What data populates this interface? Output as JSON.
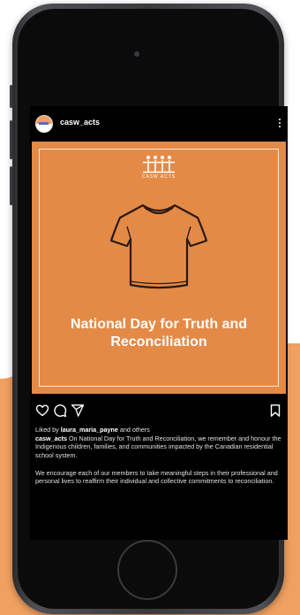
{
  "post": {
    "username": "casw_acts",
    "logo_text": "CASW ACTS",
    "image_title": "National Day for Truth and Reconciliation",
    "liked_prefix": "Liked by",
    "liked_user": "laura_maria_payne",
    "liked_suffix": "and others",
    "caption_user": "casw_acts",
    "caption_text": "On National Day for Truth and Reconciliation, we remember and honour the Indigenous children, families, and communities impacted by the Canadian residential school system.",
    "caption_text_2": "We encourage each of our members to take meaningful steps in their professional and personal lives to reaffirm their individual and collective commitments to reconciliation."
  },
  "icons": {
    "more": "more-vertical-icon",
    "like": "heart-icon",
    "comment": "comment-icon",
    "share": "send-icon",
    "save": "bookmark-icon"
  },
  "colors": {
    "post_background": "#e48a47",
    "page_accent": "#f0a060",
    "screen": "#000000"
  }
}
